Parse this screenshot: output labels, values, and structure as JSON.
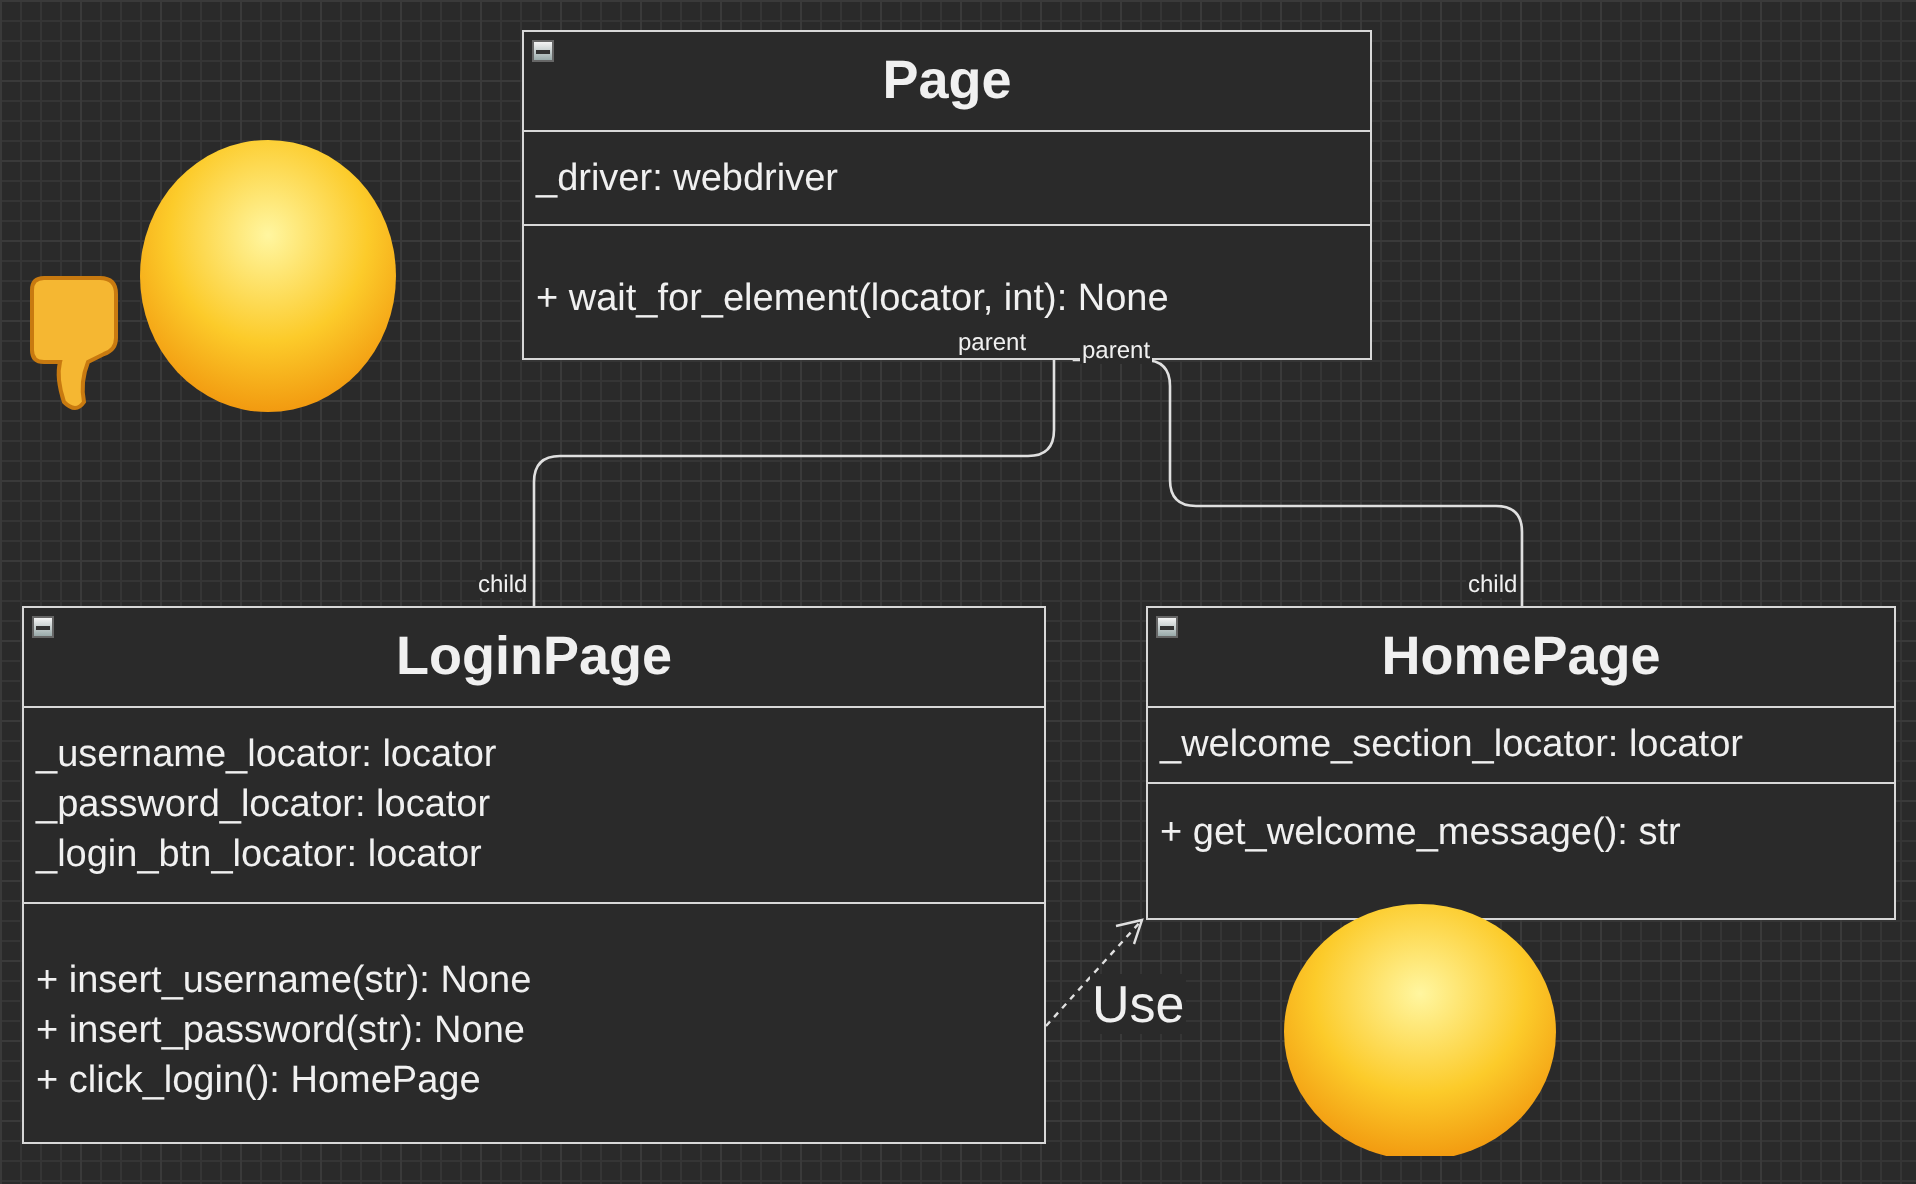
{
  "classes": [
    {
      "name": "Page",
      "attributes": [
        "_driver: webdriver"
      ],
      "methods": [
        "+ wait_for_element(locator, int): None"
      ]
    },
    {
      "name": "LoginPage",
      "attributes": [
        "_username_locator: locator",
        "_password_locator: locator",
        "_login_btn_locator: locator"
      ],
      "methods": [
        "+ insert_username(str): None",
        "+ insert_password(str): None",
        "+ click_login(): HomePage"
      ]
    },
    {
      "name": "HomePage",
      "attributes": [
        "_welcome_section_locator: locator"
      ],
      "methods": [
        "+ get_welcome_message(): str"
      ]
    }
  ],
  "connectors": [
    {
      "kind": "inheritance",
      "source_label": "parent",
      "target_label": "child"
    },
    {
      "kind": "inheritance",
      "source_label": "parent",
      "target_label": "child"
    },
    {
      "kind": "dependency",
      "label": "Use"
    }
  ]
}
